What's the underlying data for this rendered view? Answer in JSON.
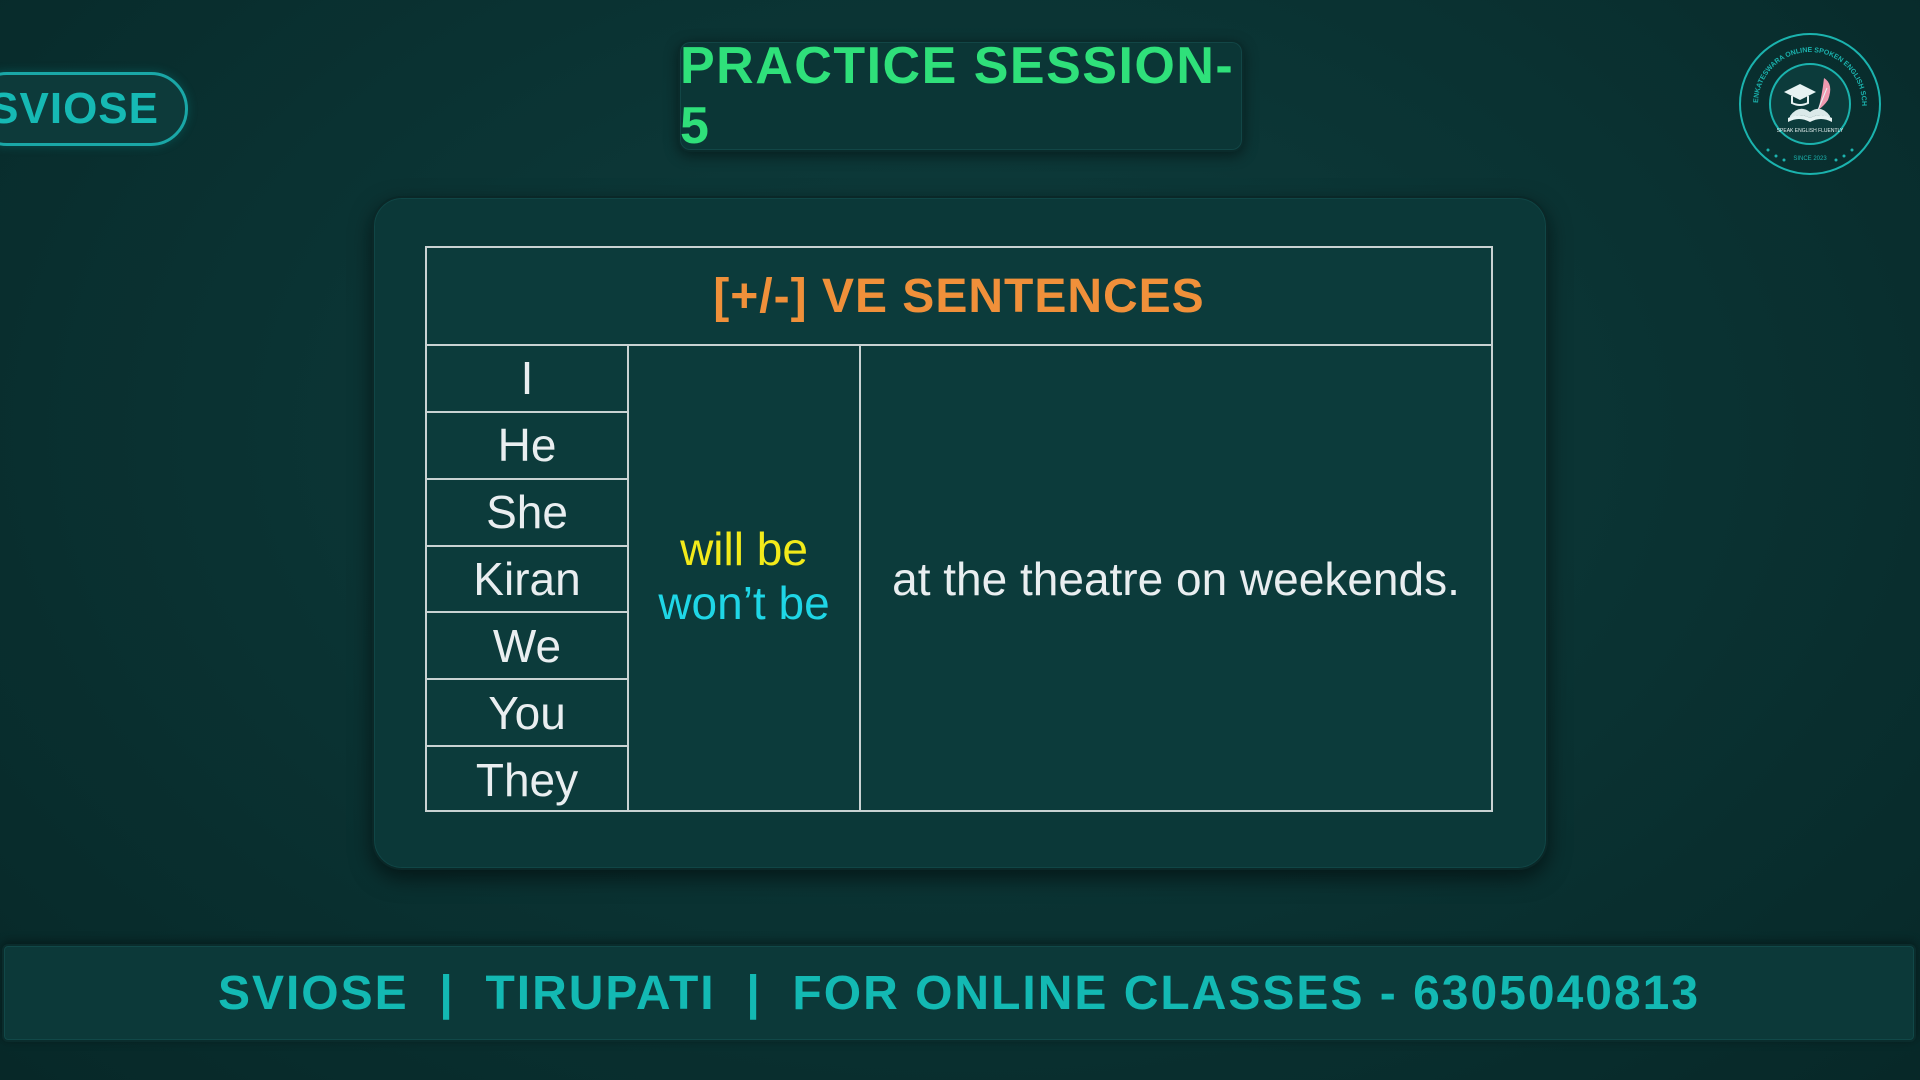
{
  "brand": {
    "label": "SVIOSE"
  },
  "title": "PRACTICE SESSION-5",
  "logo": {
    "ring_text": "SRI VENKATESWARA ONLINE SPOKEN ENGLISH SCHOOL",
    "tagline": "SPEAK ENGLISH FLUENTLY",
    "since": "SINCE 2023",
    "icon": "graduation-cap-book-quill-icon"
  },
  "grammar": {
    "heading": "[+/-] VE SENTENCES",
    "subjects": [
      "I",
      "He",
      "She",
      "Kiran",
      "We",
      "You",
      "They"
    ],
    "positive": "will be",
    "negative": "won’t be",
    "complement": "at the theatre on weekends."
  },
  "footer": {
    "text": "SVIOSE  |  TIRUPATI  |  FOR ONLINE CLASSES - 6305040813"
  },
  "colors": {
    "background": "#0a3232",
    "title": "#2fe07a",
    "heading": "#f0903a",
    "positive": "#f3ea1a",
    "negative": "#1fd6e6",
    "brand": "#16b9b4"
  }
}
